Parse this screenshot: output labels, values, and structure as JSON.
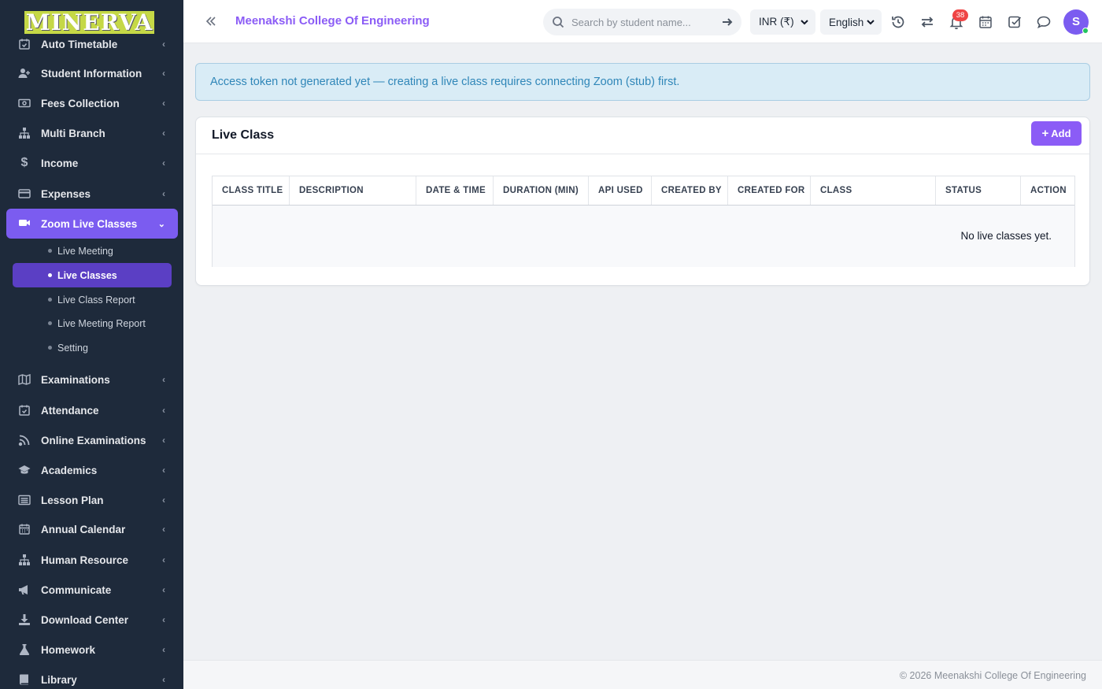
{
  "sidebar": {
    "logo": "MINERVA",
    "items": [
      {
        "label": "Auto Timetable",
        "icon": "calendar-check-icon"
      },
      {
        "label": "Student Information",
        "icon": "user-plus-icon"
      },
      {
        "label": "Fees Collection",
        "icon": "money-icon"
      },
      {
        "label": "Multi Branch",
        "icon": "sitemap-icon"
      },
      {
        "label": "Income",
        "icon": "dollar-icon"
      },
      {
        "label": "Expenses",
        "icon": "credit-card-icon"
      },
      {
        "label": "Zoom Live Classes",
        "icon": "video-icon"
      },
      {
        "label": "Examinations",
        "icon": "map-icon"
      },
      {
        "label": "Attendance",
        "icon": "calendar-check-icon"
      },
      {
        "label": "Online Examinations",
        "icon": "rss-icon"
      },
      {
        "label": "Academics",
        "icon": "graduation-cap-icon"
      },
      {
        "label": "Lesson Plan",
        "icon": "list-alt-icon"
      },
      {
        "label": "Annual Calendar",
        "icon": "calendar-icon"
      },
      {
        "label": "Human Resource",
        "icon": "sitemap-icon"
      },
      {
        "label": "Communicate",
        "icon": "bullhorn-icon"
      },
      {
        "label": "Download Center",
        "icon": "download-icon"
      },
      {
        "label": "Homework",
        "icon": "flask-icon"
      },
      {
        "label": "Library",
        "icon": "book-icon"
      }
    ],
    "subitems": [
      {
        "label": "Live Meeting"
      },
      {
        "label": "Live Classes"
      },
      {
        "label": "Live Class Report"
      },
      {
        "label": "Live Meeting Report"
      },
      {
        "label": "Setting"
      }
    ]
  },
  "header": {
    "brand": "Meenakshi College Of Engineering",
    "search_placeholder": "Search by student name...",
    "currency": "INR (₹)",
    "language": "English",
    "notification_count": "38",
    "avatar_initial": "S"
  },
  "alert": {
    "text": "Access token not generated yet — creating a live class requires connecting Zoom (stub) first."
  },
  "card": {
    "title": "Live Class",
    "add_label": "Add",
    "columns": [
      "CLASS TITLE",
      "DESCRIPTION",
      "DATE & TIME",
      "DURATION (MIN)",
      "API USED",
      "CREATED BY",
      "CREATED FOR",
      "CLASS",
      "STATUS",
      "ACTION"
    ],
    "empty_text": "No live classes yet."
  },
  "footer": {
    "text": "© 2026 Meenakshi College Of Engineering"
  },
  "colors": {
    "sidebar_bg": "#1e2a3b",
    "accent": "#7b5cf0",
    "alert_bg": "#d9ecf6",
    "alert_text": "#2f86b8",
    "badge": "#ef4444"
  }
}
